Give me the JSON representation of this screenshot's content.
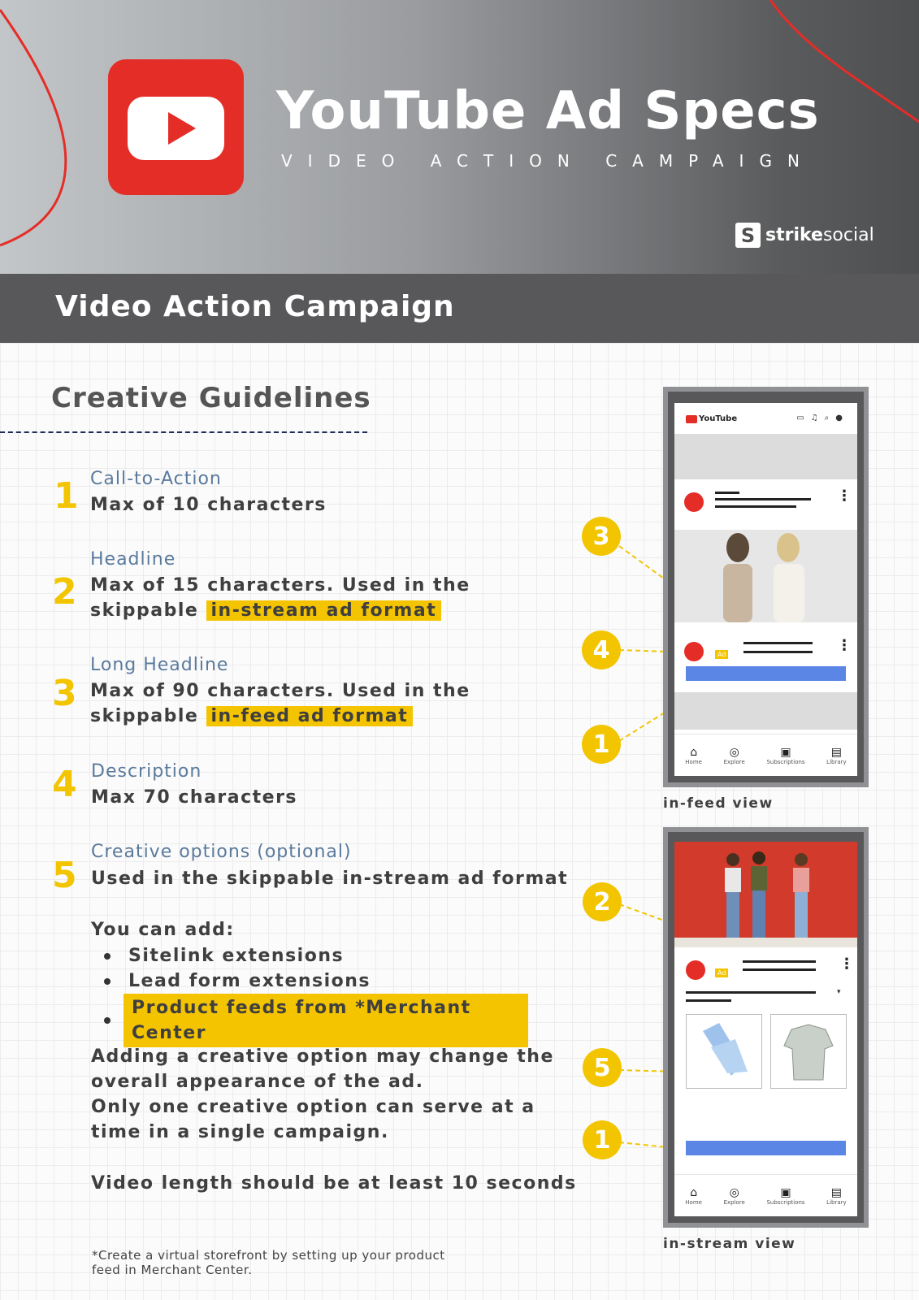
{
  "header": {
    "title": "YouTube Ad Specs",
    "subtitle": "VIDEO ACTION CAMPAIGN",
    "brand_bold": "strike",
    "brand_light": "social",
    "brand_mark": "S"
  },
  "band": {
    "title": "Video Action Campaign"
  },
  "guidelines": {
    "title": "Creative Guidelines",
    "items": [
      {
        "num": "1",
        "label": "Call-to-Action",
        "text": "Max of 10 characters"
      },
      {
        "num": "2",
        "label": "Headline",
        "text": "Max of 15 characters. Used in the",
        "text2": "skippable",
        "highlight": "in-stream ad format"
      },
      {
        "num": "3",
        "label": "Long Headline",
        "text": "Max of 90 characters. Used in the",
        "text2": "skippable",
        "highlight": "in-feed ad format"
      },
      {
        "num": "4",
        "label": "Description",
        "text": "Max 70 characters"
      },
      {
        "num": "5",
        "label": "Creative options (optional)",
        "text": "Used in the skippable in-stream ad format"
      }
    ],
    "you_can_add": "You can add:",
    "bullets": [
      "Sitelink extensions",
      "Lead form extensions",
      "Product feeds from *Merchant Center"
    ],
    "note_lines": [
      "Adding a creative option may change the",
      "overall appearance of the ad.",
      "Only one creative option can serve at a",
      "time in a single campaign."
    ],
    "video_length": "Video length should be at least 10 seconds",
    "footnote_1": "*Create a virtual storefront by setting up your product",
    "footnote_2": "feed in Merchant Center."
  },
  "mockups": {
    "infeed_caption": "in-feed view",
    "instream_caption": "in-stream view",
    "yt_wordmark": "YouTube",
    "ad_tag": "Ad",
    "nav": [
      "Home",
      "Explore",
      "Subscriptions",
      "Library"
    ],
    "infeed_badges": [
      "3",
      "4",
      "1"
    ],
    "instream_badges": [
      "2",
      "5",
      "1"
    ]
  },
  "colors": {
    "accent_yellow": "#f2c500",
    "youtube_red": "#e52d27",
    "cta_blue": "#5b86e5",
    "band_gray": "#58585a"
  }
}
